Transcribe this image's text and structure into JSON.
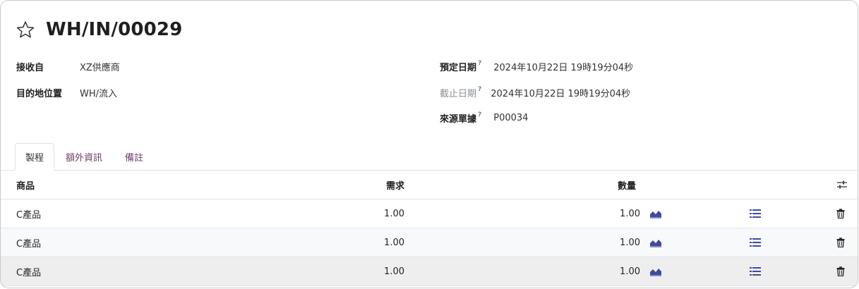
{
  "header": {
    "title": "WH/IN/00029"
  },
  "fields": {
    "partner": {
      "label": "接收自",
      "value": "XZ供應商"
    },
    "destination": {
      "label": "目的地位置",
      "value": "WH/流入"
    },
    "scheduled_date": {
      "label": "預定日期",
      "help": "?",
      "value": "2024年10月22日 19時19分04秒"
    },
    "deadline": {
      "label": "截止日期",
      "help": "?",
      "value": "2024年10月22日 19時19分04秒"
    },
    "origin": {
      "label": "來源單據",
      "help": "?",
      "value": "P00034"
    }
  },
  "tabs": [
    {
      "label": "製程",
      "active": true
    },
    {
      "label": "額外資訊",
      "active": false
    },
    {
      "label": "備註",
      "active": false
    }
  ],
  "table": {
    "columns": {
      "product": "商品",
      "demand": "需求",
      "quantity": "數量"
    },
    "rows": [
      {
        "product": "C產品",
        "demand": "1.00",
        "quantity": "1.00"
      },
      {
        "product": "C產品",
        "demand": "1.00",
        "quantity": "1.00"
      },
      {
        "product": "C產品",
        "demand": "1.00",
        "quantity": "1.00"
      }
    ]
  },
  "icons": {
    "favorite": "star-outline-icon",
    "forecast": "area-chart-icon",
    "details": "list-icon",
    "delete": "trash-icon",
    "optional_columns": "sliders-icon"
  },
  "colors": {
    "accent": "#6b3d66",
    "icon_blue": "#3e4a9e",
    "border": "#dee2e6"
  }
}
